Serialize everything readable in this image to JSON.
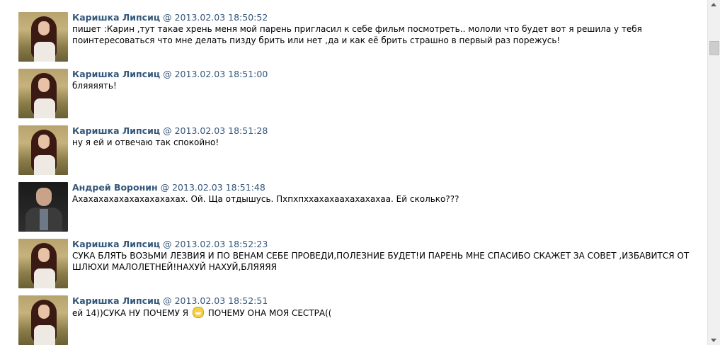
{
  "messages": [
    {
      "author": "Каришка Липсиц",
      "at": "@",
      "time": "2013.02.03 18:50:52",
      "text": "пишет :Карин ,тут такае хрень меня мой парень пригласил к себе фильм посмотреть.. мололи что будет вот я решила у тебя поинтересоваться что мне делать пизду брить или нет ,да и как её брить страшно в первый раз порежусь!"
    },
    {
      "author": "Каришка Липсиц",
      "at": "@",
      "time": "2013.02.03 18:51:00",
      "text": "бляяяять!"
    },
    {
      "author": "Каришка Липсиц",
      "at": "@",
      "time": "2013.02.03 18:51:28",
      "text": "ну я ей и отвечаю так спокойно!"
    },
    {
      "author": "Андрей Воронин",
      "at": "@",
      "time": "2013.02.03 18:51:48",
      "text": "Ахахахахахахахахахахах. Ой. Ща отдышусь. Пхпхпххахахаахахахахаа. Ей сколько???"
    },
    {
      "author": "Каришка Липсиц",
      "at": "@",
      "time": "2013.02.03 18:52:23",
      "text": "СУКА БЛЯТЬ ВОЗЬМИ ЛЕЗВИЯ И ПО ВЕНАМ СЕБЕ ПРОВЕДИ,ПОЛЕЗНИЕ БУДЕТ!И ПАРЕНЬ МНЕ СПАСИБО СКАЖЕТ ЗА СОВЕТ ,ИЗБАВИТСЯ ОТ ШЛЮХИ МАЛОЛЕТНЕЙ!НАХУЙ НАХУЙ,БЛЯЯЯЯ"
    },
    {
      "author": "Каришка Липсиц",
      "at": "@",
      "time": "2013.02.03 18:52:51",
      "text_before": "ей 14))СУКА НУ ПОЧЕМУ Я",
      "emoji": "grinning-emoji",
      "text_after": "ПОЧЕМУ ОНА МОЯ СЕСТРА(("
    }
  ],
  "scrollbar": {
    "position": 0.1
  }
}
